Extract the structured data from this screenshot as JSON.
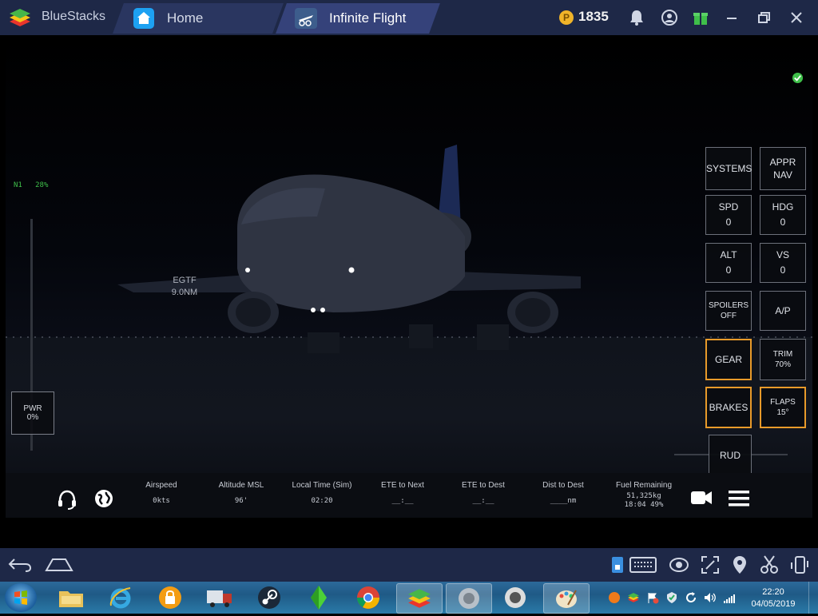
{
  "titlebar": {
    "app_name": "BlueStacks",
    "tabs": [
      {
        "label": "Home",
        "icon": "home-icon"
      },
      {
        "label": "Infinite Flight",
        "icon": "infinite-flight-icon",
        "active": true
      }
    ],
    "coins": "1835",
    "coin_symbol": "P"
  },
  "game": {
    "n1_label": "N1",
    "n1_value": "28%",
    "power": {
      "label": "PWR",
      "value": "0%"
    },
    "nav_target": {
      "waypoint": "EGTF",
      "distance": "9.0NM"
    },
    "controls": {
      "systems": "SYSTEMS",
      "appr": "APPR",
      "nav": "NAV",
      "spd_label": "SPD",
      "spd_value": "0",
      "hdg_label": "HDG",
      "hdg_value": "0",
      "alt_label": "ALT",
      "alt_value": "0",
      "vs_label": "VS",
      "vs_value": "0",
      "spoilers_label": "SPOILERS",
      "spoilers_value": "OFF",
      "autopilot": "A/P",
      "gear": "GEAR",
      "trim_label": "TRIM",
      "trim_value": "70%",
      "brakes": "BRAKES",
      "flaps_label": "FLAPS",
      "flaps_value": "15°",
      "rudder": "RUD"
    },
    "hud": [
      {
        "label": "Airspeed",
        "value": "0kts"
      },
      {
        "label": "Altitude MSL",
        "value": "96'"
      },
      {
        "label": "Local Time (Sim)",
        "value": "02:20"
      },
      {
        "label": "ETE to Next",
        "value": "__:__"
      },
      {
        "label": "ETE to Dest",
        "value": "__:__"
      },
      {
        "label": "Dist to Dest",
        "value": "____nm"
      },
      {
        "label": "Fuel Remaining",
        "value": "51,325kg\n18:04 49%"
      }
    ],
    "colors": {
      "accent_orange": "#e89a2a",
      "n1_green": "#3fbf4a"
    }
  },
  "taskbar": {
    "time": "22:20",
    "date": "04/05/2019"
  }
}
